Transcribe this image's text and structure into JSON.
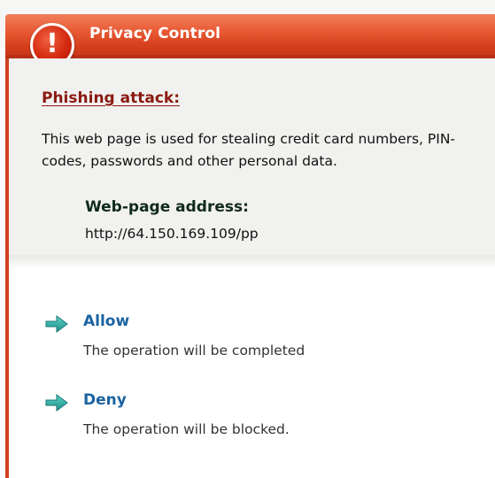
{
  "window": {
    "title": "Privacy Control"
  },
  "alert": {
    "icon": "exclamation-circle-icon",
    "heading": "Phishing attack:",
    "description": "This web page is used for stealing credit card numbers, PIN-codes, passwords and other personal data.",
    "address_label": "Web-page address:",
    "address_value": "http://64.150.169.109/pp"
  },
  "actions": [
    {
      "label": "Allow",
      "description": "The operation will be completed",
      "icon": "arrow-right-icon"
    },
    {
      "label": "Deny",
      "description": "The operation will be blocked.",
      "icon": "arrow-right-icon"
    }
  ],
  "colors": {
    "title_bar": "#d63f1c",
    "heading": "#8a1a10",
    "action_link": "#1c63a0",
    "arrow": "#2aa5a0"
  }
}
